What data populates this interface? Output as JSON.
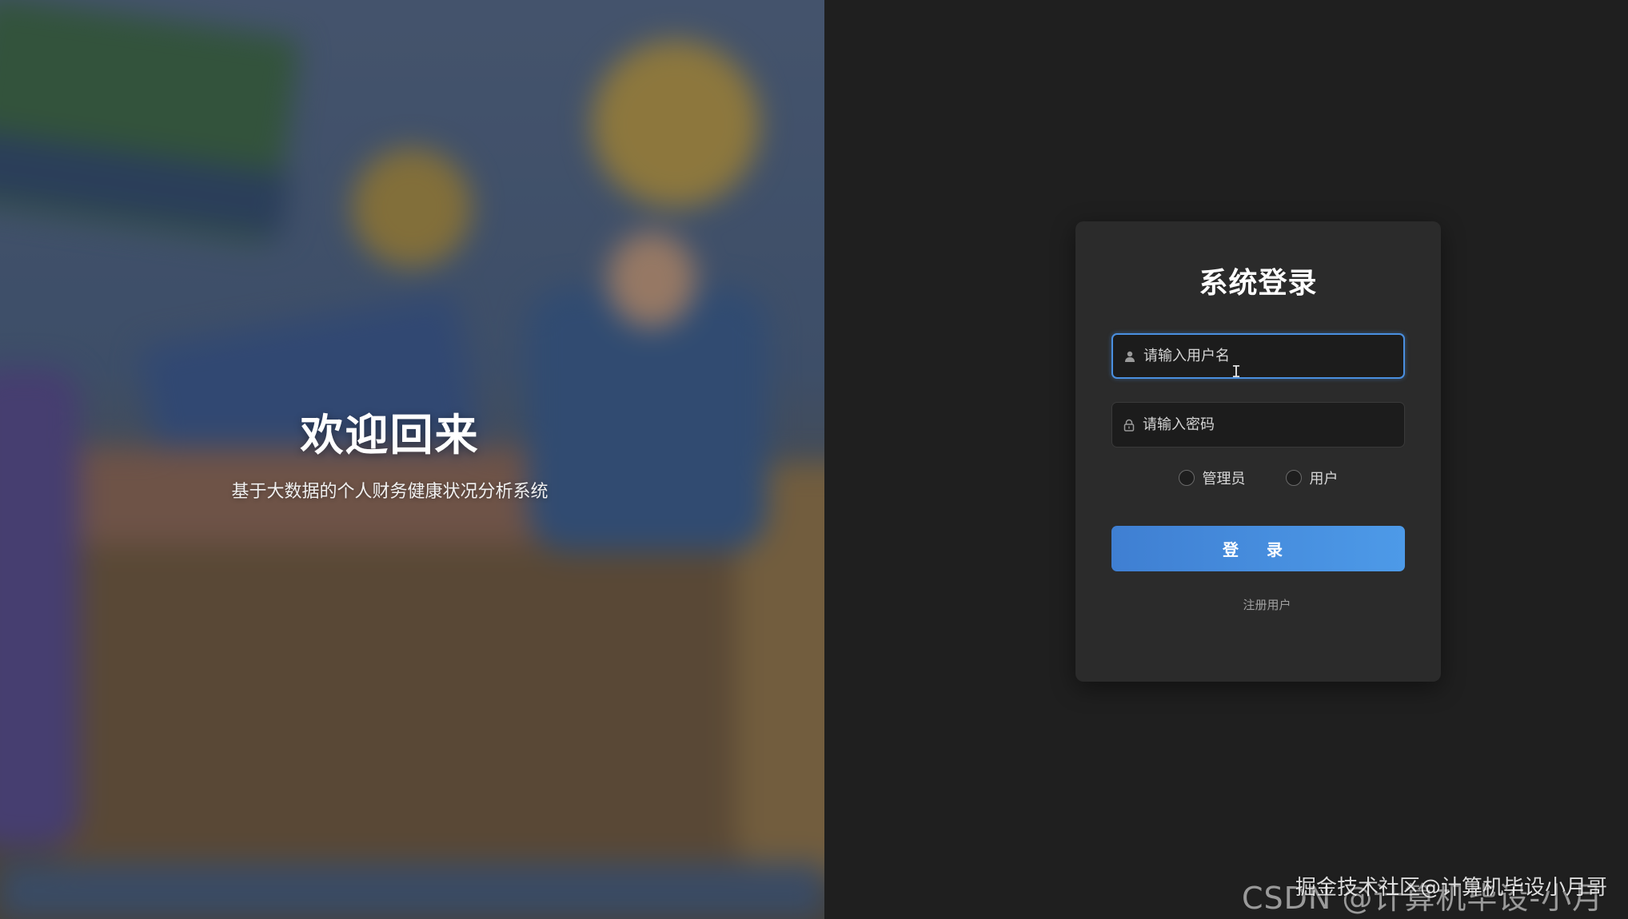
{
  "hero": {
    "title": "欢迎回来",
    "subtitle": "基于大数据的个人财务健康状况分析系统"
  },
  "login": {
    "title": "系统登录",
    "username": {
      "placeholder": "请输入用户名",
      "value": "",
      "icon": "user-icon"
    },
    "password": {
      "placeholder": "请输入密码",
      "value": "",
      "icon": "lock-icon"
    },
    "roles": [
      {
        "label": "管理员",
        "selected": false
      },
      {
        "label": "用户",
        "selected": false
      }
    ],
    "submit_label": "登 录",
    "register_label": "注册用户"
  },
  "watermarks": {
    "juejin": "掘金技术社区@计算机毕设小月哥",
    "csdn": "CSDN @计算机毕设-小月哥"
  },
  "colors": {
    "page_background": "#1f1f1f",
    "card_background": "#2b2b2b",
    "accent": "#4a8fe0",
    "button_gradient_start": "#3f7fd2",
    "button_gradient_end": "#4d9ae8"
  }
}
